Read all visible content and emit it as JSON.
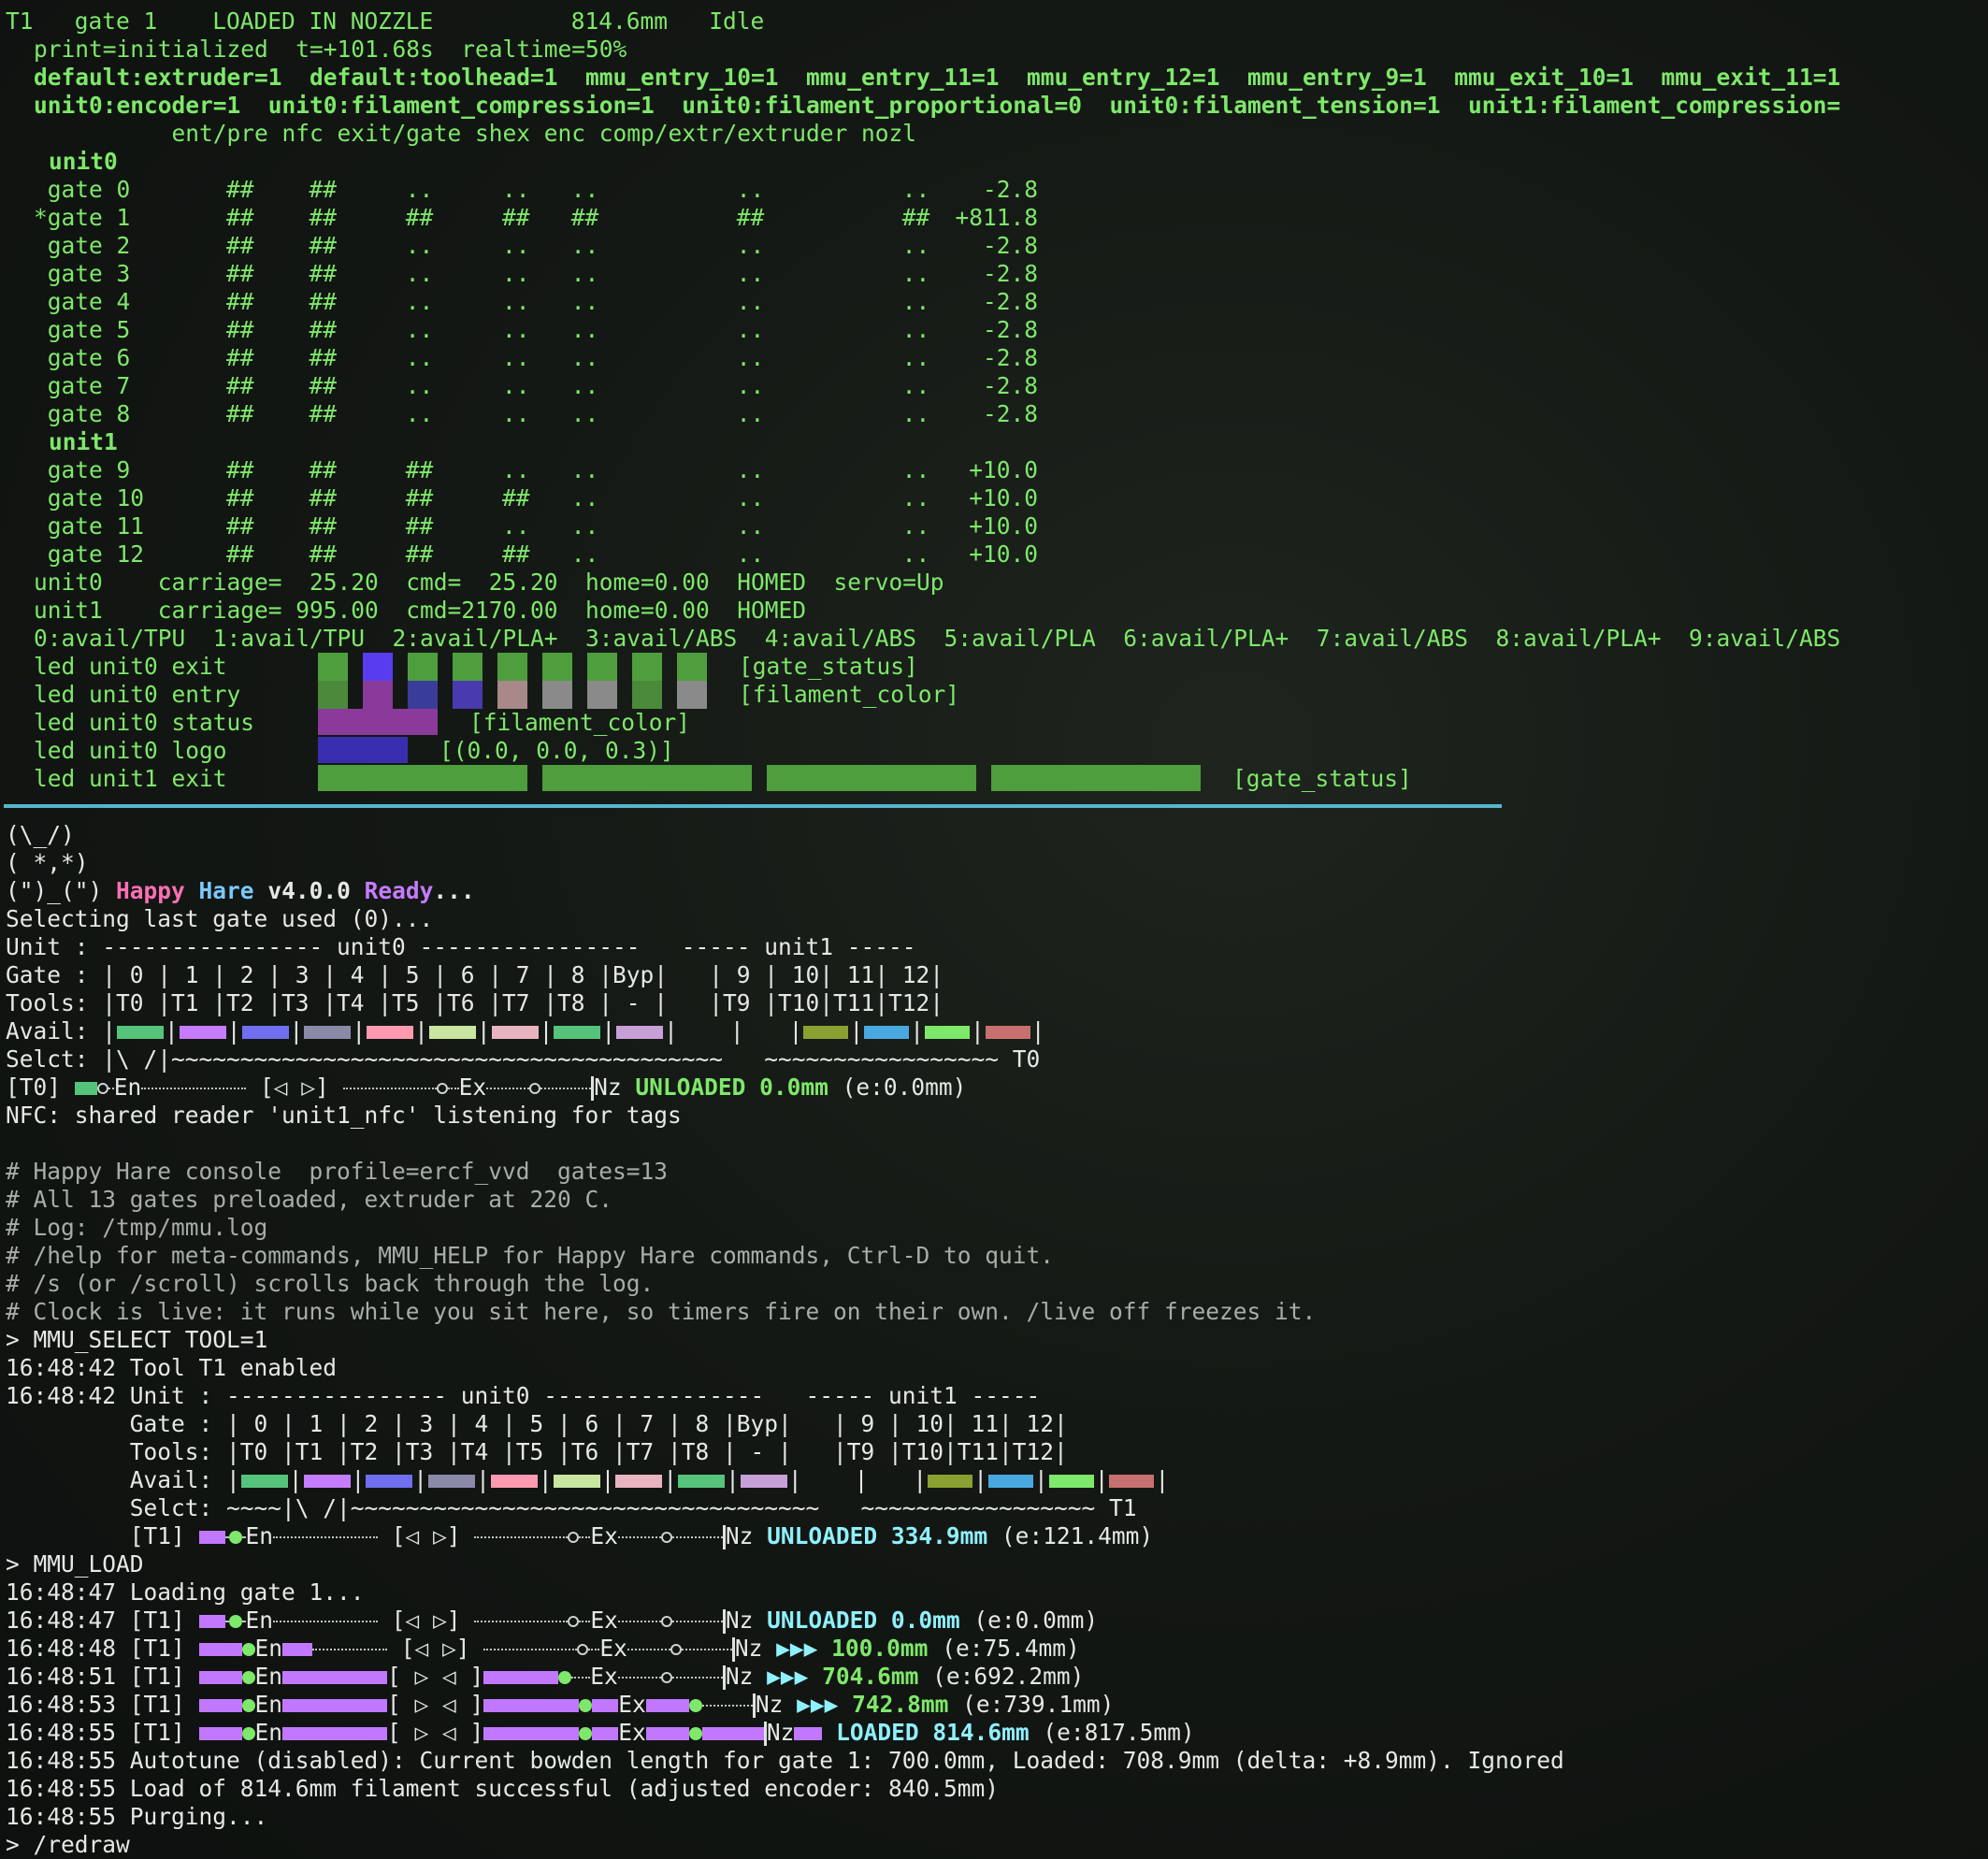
{
  "status": {
    "header": "T1   gate 1    LOADED IN NOZZLE          814.6mm   Idle",
    "print": "print=initialized  t=+101.68s  realtime=50%",
    "sensors1": "default:extruder=1  default:toolhead=1  mmu_entry_10=1  mmu_entry_11=1  mmu_entry_12=1  mmu_entry_9=1  mmu_exit_10=1  mmu_exit_11=1",
    "sensors2": "unit0:encoder=1  unit0:filament_compression=1  unit0:filament_proportional=0  unit0:filament_tension=1  unit1:filament_compression=",
    "columns": "          ent/pre nfc exit/gate shex enc comp/extr/extruder nozl"
  },
  "units": [
    {
      "name": "unit0",
      "gates": [
        {
          "label": " gate 0",
          "marks": "##    ##     ..     ..   ..          ..          ..",
          "pos": "-2.8"
        },
        {
          "label": "*gate 1",
          "marks": "##    ##     ##     ##   ##          ##          ##",
          "pos": "+811.8"
        },
        {
          "label": " gate 2",
          "marks": "##    ##     ..     ..   ..          ..          ..",
          "pos": "-2.8"
        },
        {
          "label": " gate 3",
          "marks": "##    ##     ..     ..   ..          ..          ..",
          "pos": "-2.8"
        },
        {
          "label": " gate 4",
          "marks": "##    ##     ..     ..   ..          ..          ..",
          "pos": "-2.8"
        },
        {
          "label": " gate 5",
          "marks": "##    ##     ..     ..   ..          ..          ..",
          "pos": "-2.8"
        },
        {
          "label": " gate 6",
          "marks": "##    ##     ..     ..   ..          ..          ..",
          "pos": "-2.8"
        },
        {
          "label": " gate 7",
          "marks": "##    ##     ..     ..   ..          ..          ..",
          "pos": "-2.8"
        },
        {
          "label": " gate 8",
          "marks": "##    ##     ..     ..   ..          ..          ..",
          "pos": "-2.8"
        }
      ]
    },
    {
      "name": "unit1",
      "gates": [
        {
          "label": " gate 9",
          "marks": "##    ##     ##     ..   ..          ..          ..",
          "pos": "+10.0"
        },
        {
          "label": " gate 10",
          "marks": "##    ##     ##     ##   ..          ..          ..",
          "pos": "+10.0"
        },
        {
          "label": " gate 11",
          "marks": "##    ##     ##     ..   ..          ..          ..",
          "pos": "+10.0"
        },
        {
          "label": " gate 12",
          "marks": "##    ##     ##     ##   ..          ..          ..",
          "pos": "+10.0"
        }
      ]
    }
  ],
  "carriage": {
    "unit0": "unit0    carriage=  25.20  cmd=  25.20  home=0.00  HOMED  servo=Up",
    "unit1": "unit1    carriage= 995.00  cmd=2170.00  home=0.00  HOMED"
  },
  "avail_line": "0:avail/TPU  1:avail/TPU  2:avail/PLA+  3:avail/ABS  4:avail/ABS  5:avail/PLA  6:avail/PLA+  7:avail/ABS  8:avail/PLA+  9:avail/ABS",
  "leds": {
    "labels": [
      "led unit0 exit",
      "led unit0 entry",
      "led unit0 status",
      "led unit0 logo",
      "led unit1 exit"
    ],
    "tags": [
      "[gate_status]",
      "[filament_color]",
      "[filament_color]",
      "[(0.0, 0.0, 0.3)]",
      "[gate_status]"
    ],
    "exit_colors": [
      "#4e9e3e",
      "#5a3cf0",
      "#4e9e3e",
      "#4e9e3e",
      "#4e9e3e",
      "#4e9e3e",
      "#4e9e3e",
      "#4e9e3e",
      "#4e9e3e"
    ],
    "entry_colors": [
      "#4a8a3a",
      "#8a3a9a",
      "#3a3c9a",
      "#4a3ab0",
      "#a88888",
      "#8a8a8a",
      "#8a8a8a",
      "#4a8a3a",
      "#8a8a8a"
    ],
    "status_color": "#8a3a9a",
    "logo_color": "#3a2eb0",
    "unit1_color": "#4e9e3e"
  },
  "log": {
    "art1": "(\\_/)",
    "art2": "( *,*)",
    "art3": "(\")_(\") ",
    "ready_happy": "Happy",
    "ready_hare": "Hare",
    "ready_ver": "v4.0.0",
    "ready_ready": "Ready",
    "ready_dots": "...",
    "selecting": "Selecting last gate used (0)...",
    "table_unit": "Unit : ---------------- unit0 ----------------   ----- unit1 -----",
    "table_gate": "Gate : | 0 | 1 | 2 | 3 | 4 | 5 | 6 | 7 | 8 |Byp|   | 9 | 10| 11| 12|",
    "table_tools": "Tools: |T0 |T1 |T2 |T3 |T4 |T5 |T6 |T7 |T8 | - |   |T9 |T10|T11|T12|",
    "table_avail": "Avail: |",
    "table_selct": "Selct: |\\ /|~~~~~~~~~~~~~~~~~~~~~~~~~~~~~~~~~~~~~~~~   ~~~~~~~~~~~~~~~~~ T0",
    "avail_colors": [
      "#55c47a",
      "#c57cff",
      "#6f6ff0",
      "#8a8aa8",
      "#ff9ab0",
      "#c8e6a0",
      "#e8b4c0",
      "#55c47a",
      "#c8a0d8"
    ],
    "avail_colors_u1": [
      "#8aa030",
      "#4aa8e0",
      "#7ee86a",
      "#c87070"
    ],
    "t0_prefix": "[T0] ",
    "t0_suffix": "Nz ",
    "t0_state": "UNLOADED 0.0mm",
    "t0_enc": "(e:0.0mm)",
    "nfc": "NFC: shared reader 'unit1_nfc' listening for tags",
    "c1": "# Happy Hare console  profile=ercf_vvd  gates=13",
    "c2": "# All 13 gates preloaded, extruder at 220 C.",
    "c3": "# Log: /tmp/mmu.log",
    "c4": "# /help for meta-commands, MMU_HELP for Happy Hare commands, Ctrl-D to quit.",
    "c5": "# /s (or /scroll) scrolls back through the log.",
    "c6": "# Clock is live: it runs while you sit here, so timers fire on their own. /live off freezes it.",
    "cmd1": "> MMU_SELECT TOOL=1",
    "e1": "16:48:42 Tool T1 enabled",
    "e2": "16:48:42 Unit : ---------------- unit0 ----------------   ----- unit1 -----",
    "e3": "         Gate : | 0 | 1 | 2 | 3 | 4 | 5 | 6 | 7 | 8 |Byp|   | 9 | 10| 11| 12|",
    "e4": "         Tools: |T0 |T1 |T2 |T3 |T4 |T5 |T6 |T7 |T8 | - |   |T9 |T10|T11|T12|",
    "e5": "         Avail: |",
    "e6": "         Selct: ~~~~|\\ /|~~~~~~~~~~~~~~~~~~~~~~~~~~~~~~~~~~   ~~~~~~~~~~~~~~~~~ T1",
    "e7_prefix": "         [T1] ",
    "e7_state": "UNLOADED 334.9mm",
    "e7_enc": "(e:121.4mm)",
    "cmd2": "> MMU_LOAD",
    "l1": "16:48:47 Loading gate 1...",
    "p1_time": "16:48:47 [T1] ",
    "p1_state": "UNLOADED 0.0mm",
    "p1_enc": "(e:0.0mm)",
    "p2_time": "16:48:48 [T1] ",
    "p2_state": "100.0mm",
    "p2_enc": "(e:75.4mm)",
    "p3_time": "16:48:51 [T1] ",
    "p3_state": "704.6mm",
    "p3_enc": "(e:692.2mm)",
    "p4_time": "16:48:53 [T1] ",
    "p4_state": "742.8mm",
    "p4_enc": "(e:739.1mm)",
    "p5_time": "16:48:55 [T1] ",
    "p5_state": "LOADED 814.6mm",
    "p5_enc": "(e:817.5mm)",
    "arrows": "▶▶▶",
    "en": "En",
    "ex": "Ex",
    "nz": "Nz",
    "sel_idle": "[◁ ▷]",
    "sel_active": "[ ▷ ◁ ]",
    "l2": "16:48:55 Autotune (disabled): Current bowden length for gate 1: 700.0mm, Loaded: 708.9mm (delta: +8.9mm). Ignored",
    "l3": "16:48:55 Load of 814.6mm filament successful (adjusted encoder: 840.5mm)",
    "l4": "16:48:55 Purging...",
    "cmd3": "> /redraw"
  }
}
